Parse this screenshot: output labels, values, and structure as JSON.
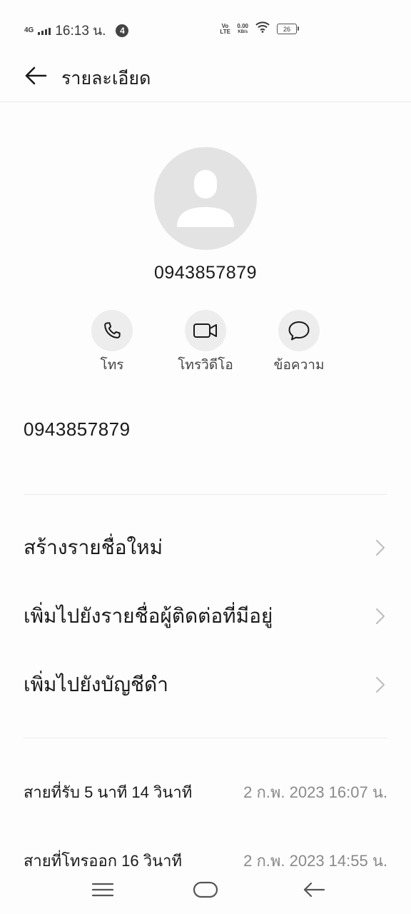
{
  "status_bar": {
    "network": "4G",
    "time": "16:13 น.",
    "notification_count": "4",
    "volte": "Vo LTE",
    "speed_value": "0.00",
    "speed_unit": "KB/s",
    "battery": "26"
  },
  "header": {
    "title": "รายละเอียด"
  },
  "contact": {
    "number": "0943857879"
  },
  "actions": [
    {
      "label": "โทร",
      "icon": "phone-icon"
    },
    {
      "label": "โทรวิดีโอ",
      "icon": "video-icon"
    },
    {
      "label": "ข้อความ",
      "icon": "message-icon"
    }
  ],
  "phone_line": "0943857879",
  "menu": [
    {
      "label": "สร้างรายชื่อใหม่"
    },
    {
      "label": "เพิ่มไปยังรายชื่อผู้ติดต่อที่มีอยู่"
    },
    {
      "label": "เพิ่มไปยังบัญชีดำ"
    }
  ],
  "history": [
    {
      "type": "สายที่รับ 5 นาที 14 วินาที",
      "time": "2 ก.พ. 2023  16:07 น."
    },
    {
      "type": "สายที่โทรออก 16 วินาที",
      "time": "2 ก.พ. 2023  14:55 น."
    }
  ],
  "colors": {
    "avatar_bg": "#e3e3e3",
    "action_bg": "#ededed",
    "muted_text": "#8a8a8a"
  }
}
